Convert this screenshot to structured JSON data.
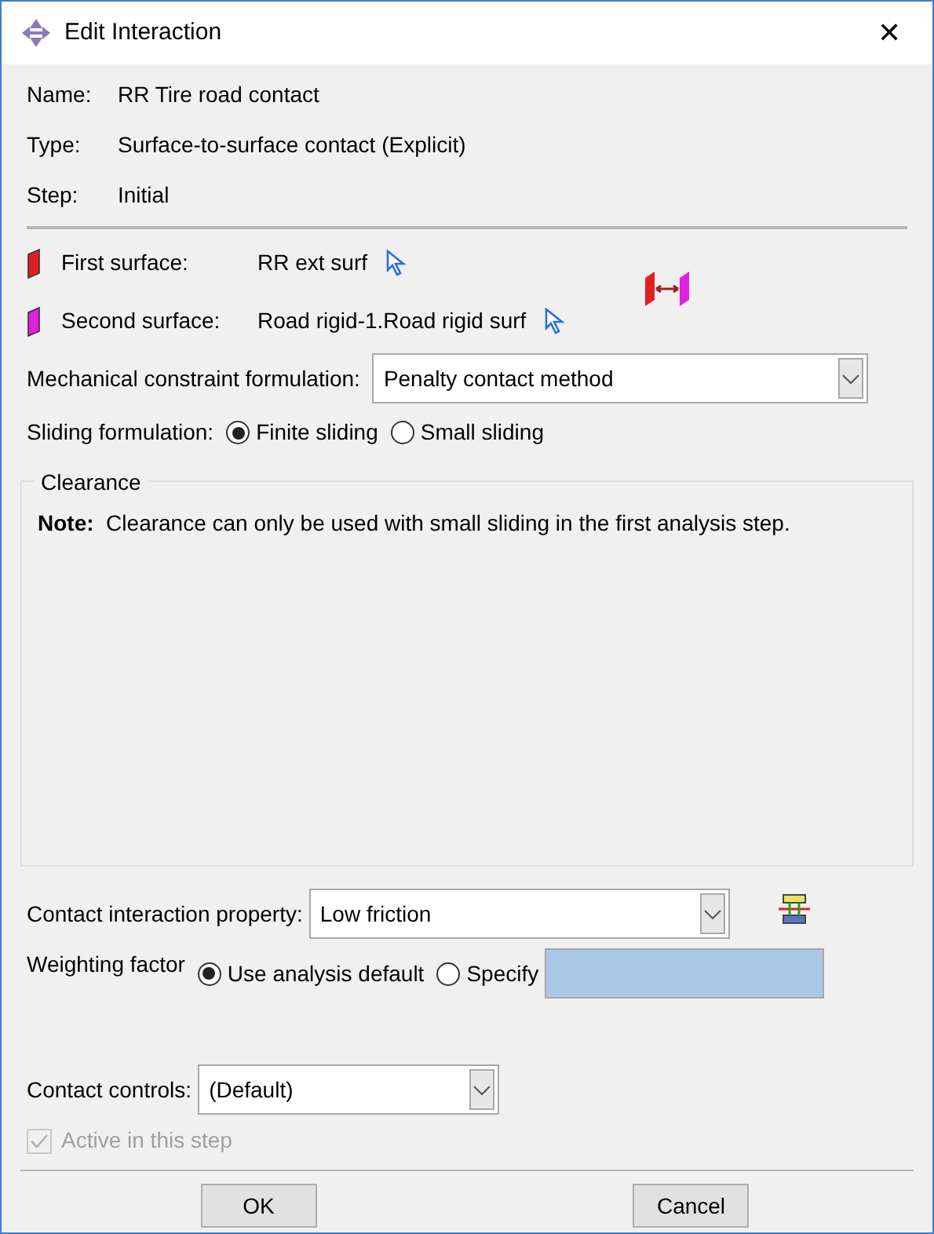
{
  "window": {
    "title": "Edit Interaction",
    "close": "✕"
  },
  "info": [
    {
      "label": "Name:",
      "value": "RR Tire road contact"
    },
    {
      "label": "Type:",
      "value": "Surface-to-surface contact (Explicit)"
    },
    {
      "label": "Step:",
      "value": "Initial"
    }
  ],
  "surfaces": [
    {
      "label": "First surface:",
      "value": "RR ext surf",
      "color": "#e02020"
    },
    {
      "label": "Second surface:",
      "value": "Road rigid-1.Road rigid surf",
      "color": "#e020e0"
    }
  ],
  "mechanical_constraint": {
    "label": "Mechanical constraint formulation:",
    "value": "Penalty contact method"
  },
  "sliding": {
    "label": "Sliding formulation:",
    "options": [
      {
        "label": "Finite sliding",
        "selected": true
      },
      {
        "label": "Small sliding",
        "selected": false
      }
    ]
  },
  "clearance": {
    "title": "Clearance",
    "note": "**Note:**  Clearance can only be used with small sliding in the first analysis step."
  },
  "contact_property": {
    "label": "Contact interaction property:",
    "value": "Low friction"
  },
  "weighting": {
    "label": "Weighting factor",
    "options": [
      {
        "label": "Use analysis default",
        "selected": true
      },
      {
        "label": "Specify",
        "selected": false
      }
    ],
    "specify_disabled": true
  },
  "contact_controls": {
    "label": "Contact controls:",
    "value": "(Default)"
  },
  "active": {
    "label": "Active in this step",
    "checked": true,
    "disabled": true
  },
  "buttons": [
    "OK",
    "Cancel"
  ]
}
